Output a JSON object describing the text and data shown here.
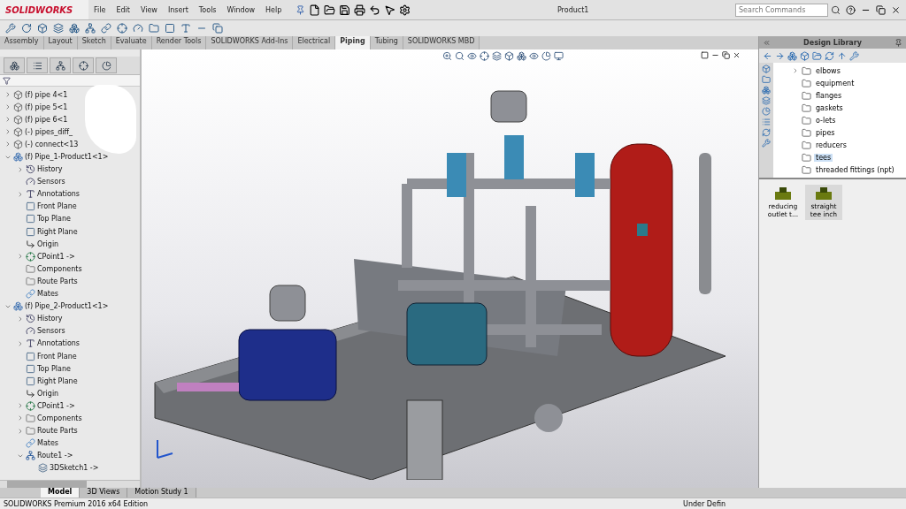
{
  "app": {
    "logo": "SOLIDWORKS",
    "title": "Product1",
    "menu": [
      "File",
      "Edit",
      "View",
      "Insert",
      "Tools",
      "Window",
      "Help"
    ],
    "search": {
      "placeholder": "Search Commands"
    }
  },
  "tabs": [
    {
      "label": "Assembly",
      "selected": false
    },
    {
      "label": "Layout",
      "selected": false
    },
    {
      "label": "Sketch",
      "selected": false
    },
    {
      "label": "Evaluate",
      "selected": false
    },
    {
      "label": "Render Tools",
      "selected": false
    },
    {
      "label": "SOLIDWORKS Add-Ins",
      "selected": false
    },
    {
      "label": "Electrical",
      "selected": false
    },
    {
      "label": "Piping",
      "selected": true
    },
    {
      "label": "Tubing",
      "selected": false
    },
    {
      "label": "SOLIDWORKS MBD",
      "selected": false
    }
  ],
  "tree": [
    {
      "label": "(f) pipe 4<1",
      "kind": "part",
      "expanded": false
    },
    {
      "label": "(f) pipe 5<1",
      "kind": "part",
      "expanded": false
    },
    {
      "label": "(f) pipe 6<1",
      "kind": "part",
      "expanded": false
    },
    {
      "label": "(-) pipes_diff_",
      "kind": "part",
      "expanded": false
    },
    {
      "label": "(-) connect<13",
      "kind": "part",
      "expanded": false
    },
    {
      "label": "(f) Pipe_1-Product1<1>",
      "kind": "assembly",
      "expanded": true,
      "children": [
        {
          "label": "History",
          "kind": "history",
          "expanded": false
        },
        {
          "label": "Sensors",
          "kind": "sensors"
        },
        {
          "label": "Annotations",
          "kind": "annotations",
          "expanded": false
        },
        {
          "label": "Front Plane",
          "kind": "plane"
        },
        {
          "label": "Top Plane",
          "kind": "plane"
        },
        {
          "label": "Right Plane",
          "kind": "plane"
        },
        {
          "label": "Origin",
          "kind": "origin"
        },
        {
          "label": "CPoint1 ->",
          "kind": "cpoint",
          "expanded": false
        },
        {
          "label": "Components",
          "kind": "folder"
        },
        {
          "label": "Route Parts",
          "kind": "folder"
        },
        {
          "label": "Mates",
          "kind": "mates"
        }
      ]
    },
    {
      "label": "(f) Pipe_2-Product1<1>",
      "kind": "assembly",
      "expanded": true,
      "children": [
        {
          "label": "History",
          "kind": "history",
          "expanded": false
        },
        {
          "label": "Sensors",
          "kind": "sensors"
        },
        {
          "label": "Annotations",
          "kind": "annotations",
          "expanded": false
        },
        {
          "label": "Front Plane",
          "kind": "plane"
        },
        {
          "label": "Top Plane",
          "kind": "plane"
        },
        {
          "label": "Right Plane",
          "kind": "plane"
        },
        {
          "label": "Origin",
          "kind": "origin"
        },
        {
          "label": "CPoint1 ->",
          "kind": "cpoint",
          "expanded": false
        },
        {
          "label": "Components",
          "kind": "folder",
          "expanded": false
        },
        {
          "label": "Route Parts",
          "kind": "folder",
          "expanded": false
        },
        {
          "label": "Mates",
          "kind": "mates"
        },
        {
          "label": "Route1 ->",
          "kind": "route",
          "expanded": true,
          "children": [
            {
              "label": "3DSketch1 ->",
              "kind": "sketch"
            }
          ]
        }
      ]
    }
  ],
  "design_library": {
    "title": "Design Library",
    "folders": [
      {
        "label": "elbows",
        "expanded": false,
        "selected": false
      },
      {
        "label": "equipment",
        "selected": false
      },
      {
        "label": "flanges",
        "selected": false
      },
      {
        "label": "gaskets",
        "selected": false
      },
      {
        "label": "o-lets",
        "selected": false
      },
      {
        "label": "pipes",
        "selected": false
      },
      {
        "label": "reducers",
        "selected": false
      },
      {
        "label": "tees",
        "selected": true
      },
      {
        "label": "threaded fittings (npt)",
        "selected": false
      }
    ],
    "items": [
      {
        "label": "reducing outlet t...",
        "selected": false
      },
      {
        "label": "straight tee inch",
        "selected": true
      }
    ]
  },
  "bottom_tabs": [
    {
      "label": "Model",
      "selected": true
    },
    {
      "label": "3D Views",
      "selected": false
    },
    {
      "label": "Motion Study 1",
      "selected": false
    }
  ],
  "status_bar": {
    "edition": "SOLIDWORKS Premium 2016 x64 Edition",
    "state": "Under Defin"
  }
}
